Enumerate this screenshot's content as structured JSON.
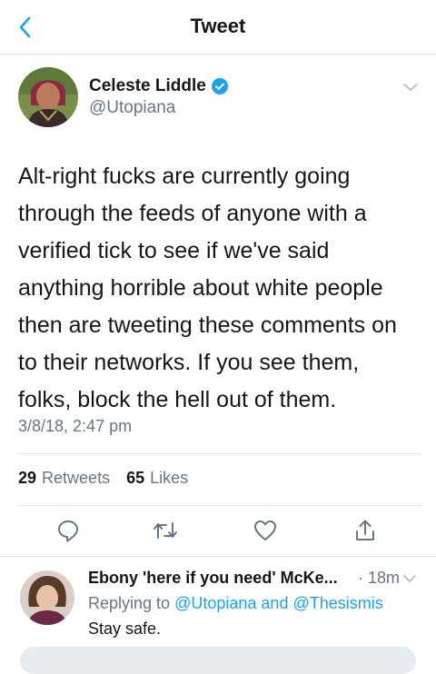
{
  "nav": {
    "title": "Tweet"
  },
  "tweet": {
    "author_name": "Celeste Liddle",
    "author_handle": "@Utopiana",
    "text": "Alt-right fucks are currently going\nthrough the feeds of anyone with a\nverified tick to see if we've said\nanything horrible about white people\nthen are tweeting these comments on\nto their networks. If you see them,\nfolks, block the hell out of them.",
    "timestamp": "3/8/18, 2:47 pm",
    "retweets_count": "29",
    "retweets_label": "Retweets",
    "likes_count": "65",
    "likes_label": "Likes"
  },
  "reply": {
    "author_name": "Ebony 'here if you need' McKe...",
    "time": "· 18m",
    "replying_label": "Replying to",
    "mention_1": "@Utopiana",
    "and_label": "and",
    "mention_2": "@Thesismis",
    "text": "Stay safe."
  },
  "colors": {
    "accent": "#1da1f2",
    "secondary_text": "#657786",
    "divider": "#e1e8ed"
  }
}
